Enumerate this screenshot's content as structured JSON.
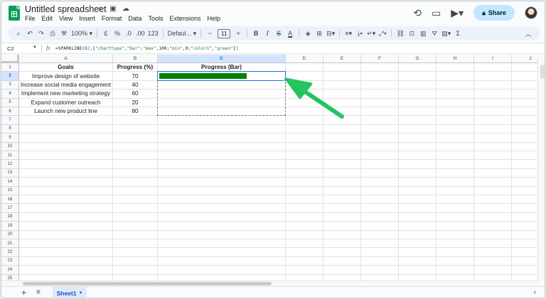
{
  "header": {
    "title": "Untitled spreadsheet",
    "menu": [
      "File",
      "Edit",
      "View",
      "Insert",
      "Format",
      "Data",
      "Tools",
      "Extensions",
      "Help"
    ],
    "share_label": "Share"
  },
  "toolbar": {
    "zoom": "100%",
    "currency": "£",
    "percent": "%",
    "dec_decrease": ".0",
    "dec_increase": ".00",
    "number_format": "123",
    "font": "Defaul...",
    "font_size": "11",
    "bold": "B",
    "italic": "I",
    "strike": "S",
    "text_color": "A",
    "sum": "Σ"
  },
  "formula_bar": {
    "cell_ref": "C2",
    "fx": "fx",
    "formula_prefix": "=SPARKLINE(",
    "formula_ref": "B2",
    "formula_mid": ",{",
    "formula_rest_1": "\"charttype\"",
    "formula_rest_2": ",",
    "formula_rest_3": "\"bar\"",
    "formula_rest_4": ";",
    "formula_rest_5": "\"max\"",
    "formula_rest_6": ",100;",
    "formula_rest_7": "\"min\"",
    "formula_rest_8": ",0;",
    "formula_rest_9": "\"color1\"",
    "formula_rest_10": ",",
    "formula_rest_11": "\"green\"",
    "formula_suffix": "})"
  },
  "columns": [
    "A",
    "B",
    "C",
    "D",
    "E",
    "F",
    "G",
    "H",
    "I",
    "J"
  ],
  "rows": [
    "1",
    "2",
    "3",
    "4",
    "5",
    "6",
    "7",
    "8",
    "9",
    "10",
    "11",
    "12",
    "13",
    "14",
    "15",
    "16",
    "17",
    "18",
    "19",
    "20",
    "21",
    "22",
    "23",
    "24",
    "25"
  ],
  "table": {
    "headers": [
      "Goals",
      "Progress (%)",
      "Progress (Bar)"
    ],
    "rows": [
      {
        "goal": "Improve design of website",
        "progress": "70"
      },
      {
        "goal": "Increase social media engagement",
        "progress": "40"
      },
      {
        "goal": "Implement new marketing strategy",
        "progress": "60"
      },
      {
        "goal": "Expand customer outreach",
        "progress": "20"
      },
      {
        "goal": "Launch new product line",
        "progress": "80"
      }
    ]
  },
  "sparkline": {
    "value": 70,
    "max": 100,
    "min": 0,
    "color": "#008000"
  },
  "selection": {
    "cell": "C2"
  },
  "sheet_tabs": [
    {
      "label": "Sheet1"
    }
  ],
  "colors": {
    "accent": "#1a73e8",
    "arrow": "#22c55e",
    "share_bg": "#c2e7ff"
  }
}
